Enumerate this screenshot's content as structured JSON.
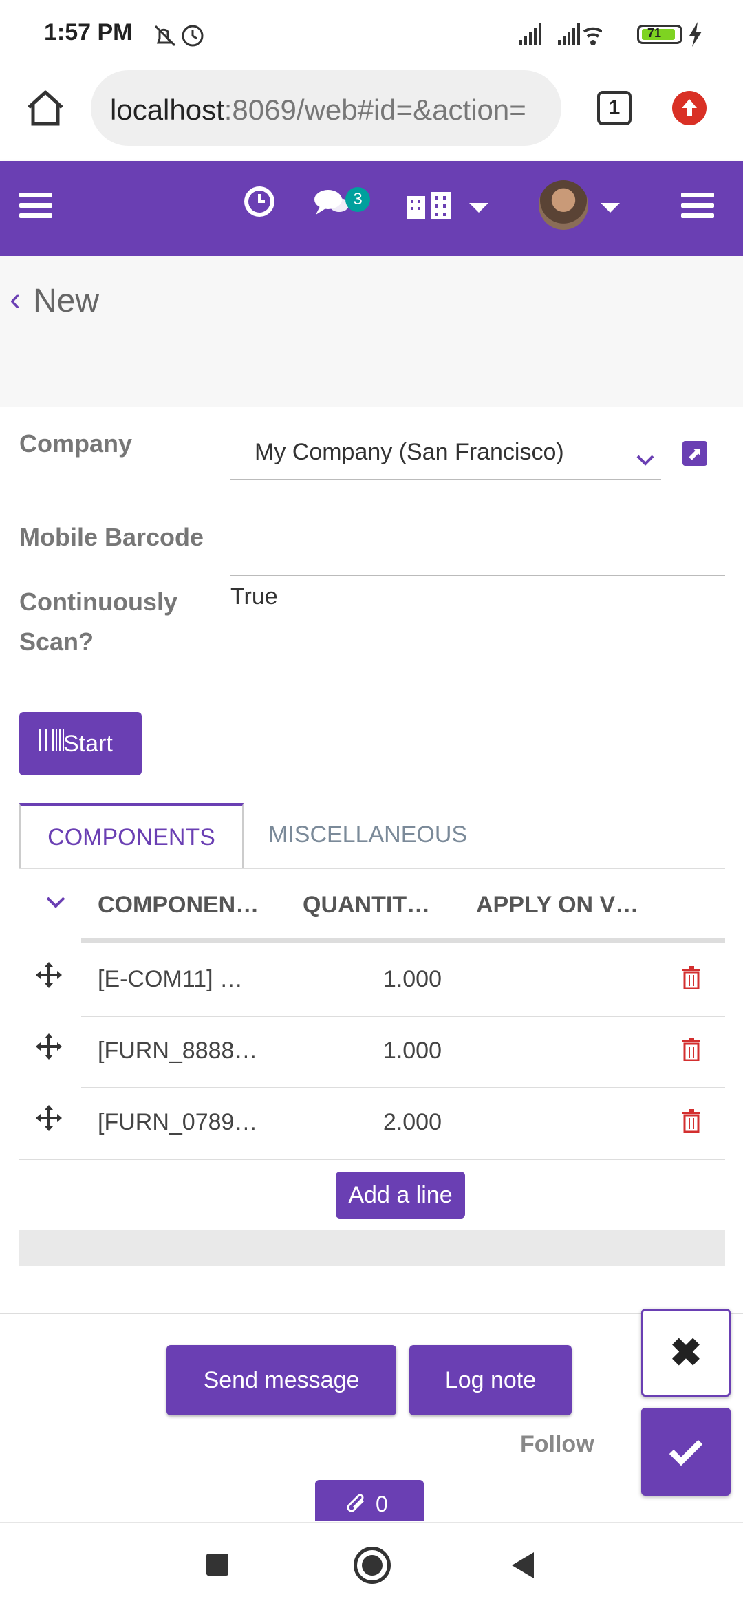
{
  "status_bar": {
    "time": "1:57 PM",
    "battery": "71"
  },
  "browser": {
    "url_host": "localhost",
    "url_rest": ":8069/web#id=&action=",
    "tab_count": "1"
  },
  "navbar": {
    "messages_badge": "3"
  },
  "breadcrumb": {
    "title": "New"
  },
  "form": {
    "company_label": "Company",
    "company_value": "My Company (San Francisco)",
    "barcode_label": "Mobile Barcode",
    "scan_label": "Continuously Scan?",
    "scan_value": "True",
    "start_label": "Start"
  },
  "tabs": [
    {
      "label": "COMPONENTS"
    },
    {
      "label": "MISCELLANEOUS"
    }
  ],
  "table": {
    "headers": [
      "COMPONEN…",
      "QUANTIT…",
      "APPLY ON V…"
    ],
    "rows": [
      {
        "component": "[E-COM11] …",
        "quantity": "1.000"
      },
      {
        "component": "[FURN_8888…",
        "quantity": "1.000"
      },
      {
        "component": "[FURN_0789…",
        "quantity": "2.000"
      }
    ],
    "add_line": "Add a line"
  },
  "chatter": {
    "send_message": "Send message",
    "log_note": "Log note",
    "follow": "Follow",
    "attachments": "0"
  },
  "colors": {
    "primary": "#6a3fb3",
    "badge": "#00a09d",
    "danger": "#d32f2f"
  }
}
